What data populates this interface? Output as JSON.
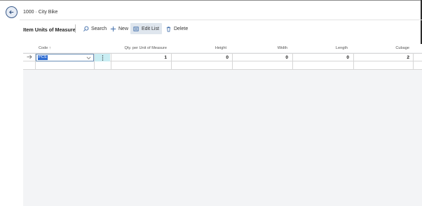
{
  "page": {
    "title": "1000 · City Bike"
  },
  "list": {
    "title": "Item Units of Measure"
  },
  "actions": [
    {
      "label": "Search",
      "icon": "search-icon"
    },
    {
      "label": "New",
      "icon": "plus-icon"
    },
    {
      "label": "Edit List",
      "icon": "edit-list-icon",
      "active": true
    },
    {
      "label": "Delete",
      "icon": "trash-icon"
    }
  ],
  "columns": {
    "code": "Code ↑",
    "qty": "Qty. per Unit of Measure",
    "height": "Height",
    "width": "Width",
    "length": "Length",
    "cubage": "Cubage"
  },
  "rows": [
    {
      "code": "PCS",
      "qty": "1",
      "height": "0",
      "width": "0",
      "length": "0",
      "cubage": "2"
    }
  ],
  "colors": {
    "accent": "#2d6bd1",
    "selected_cell": "#c9edf3",
    "grid_bg": "#f3f4f6"
  }
}
